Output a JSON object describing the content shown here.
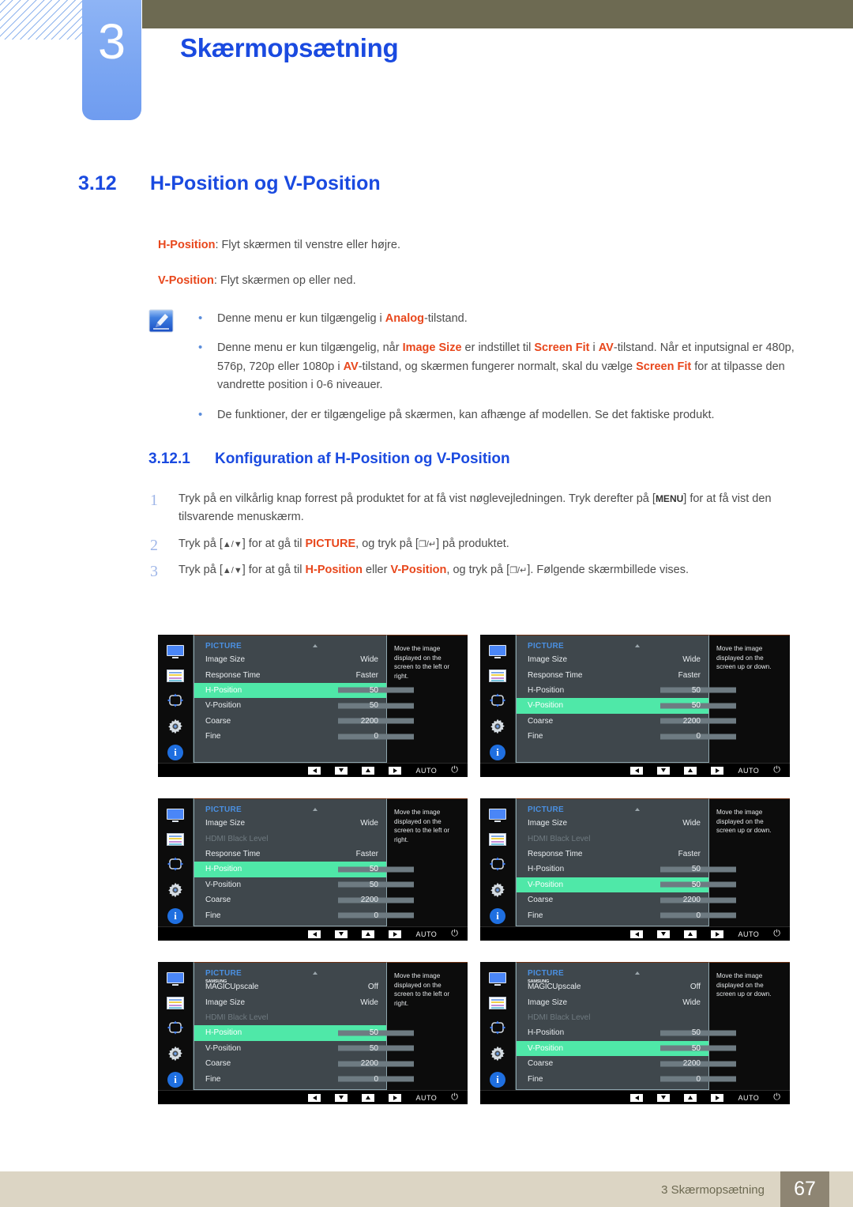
{
  "header": {
    "chapter_number": "3",
    "chapter_title": "Skærmopsætning"
  },
  "section": {
    "number": "3.12",
    "title": "H-Position og V-Position",
    "paragraph1_key": "H-Position",
    "paragraph1_text": ": Flyt skærmen til venstre eller højre.",
    "paragraph2_key": "V-Position",
    "paragraph2_text": ": Flyt skærmen op eller ned."
  },
  "notes": {
    "icon": "note-pencil-icon",
    "items": [
      "Denne menu er kun tilgængelig i Analog-tilstand.",
      "Denne menu er kun tilgængelig, når Image Size er indstillet til Screen Fit i AV-tilstand. Når et inputsignal er 480p, 576p, 720p eller 1080p i AV-tilstand, og skærmen fungerer normalt, skal du vælge Screen Fit for at tilpasse den vandrette position i 0-6 niveauer.",
      "De funktioner, der er tilgængelige på skærmen, kan afhænge af modellen. Se det faktiske produkt."
    ]
  },
  "subsection": {
    "number": "3.12.1",
    "title": "Konfiguration af H-Position og V-Position",
    "steps": [
      {
        "n": "1",
        "text": "Tryk på en vilkårlig knap forrest på produktet for at få vist nøglevejledningen. Tryk derefter på [MENU] for at få vist den tilsvarende menuskærm."
      },
      {
        "n": "2",
        "text": "Tryk på [▲/▼] for at gå til PICTURE, og tryk på [□/↵] på produktet."
      },
      {
        "n": "3",
        "text": "Tryk på [▲/▼] for at gå til H-Position eller V-Position, og tryk på [□/↵]. Følgende skærmbillede vises."
      }
    ]
  },
  "osd": {
    "menu_title": "PICTURE",
    "sidebar_icons": [
      "monitor-icon",
      "picture-bars-icon",
      "move-arrows-icon",
      "gear-icon",
      "info-icon"
    ],
    "footer_buttons": [
      "left-arrow-button",
      "down-arrow-button",
      "up-arrow-button",
      "right-arrow-button"
    ],
    "auto_label": "AUTO",
    "power_icon": "power-icon",
    "help_left": "Move the image displayed on the screen to the left or right.",
    "help_updown": "Move the image displayed on the screen up or down.",
    "accent_highlight": "#4fe8a8",
    "title_color": "#4a90e2",
    "panels": [
      {
        "id": "panel-1-h-position",
        "help": "Move the image displayed on the screen to the left or right.",
        "rows": [
          {
            "label": "Image Size",
            "value": "Wide",
            "type": "value",
            "state": "normal"
          },
          {
            "label": "Response Time",
            "value": "Faster",
            "type": "value",
            "state": "normal"
          },
          {
            "label": "H-Position",
            "value": "50",
            "type": "slider",
            "fill": 50,
            "state": "selected"
          },
          {
            "label": "V-Position",
            "value": "50",
            "type": "slider",
            "fill": 50,
            "state": "normal"
          },
          {
            "label": "Coarse",
            "value": "2200",
            "type": "slider",
            "fill": 50,
            "state": "normal"
          },
          {
            "label": "Fine",
            "value": "0",
            "type": "slider",
            "fill": 0,
            "state": "normal"
          }
        ]
      },
      {
        "id": "panel-2-v-position",
        "help": "Move the image displayed on the screen up or down.",
        "rows": [
          {
            "label": "Image Size",
            "value": "Wide",
            "type": "value",
            "state": "normal"
          },
          {
            "label": "Response Time",
            "value": "Faster",
            "type": "value",
            "state": "normal"
          },
          {
            "label": "H-Position",
            "value": "50",
            "type": "slider",
            "fill": 50,
            "state": "normal"
          },
          {
            "label": "V-Position",
            "value": "50",
            "type": "slider",
            "fill": 50,
            "state": "selected"
          },
          {
            "label": "Coarse",
            "value": "2200",
            "type": "slider",
            "fill": 50,
            "state": "normal"
          },
          {
            "label": "Fine",
            "value": "0",
            "type": "slider",
            "fill": 0,
            "state": "normal"
          }
        ]
      },
      {
        "id": "panel-3-h-position-hdmi",
        "help": "Move the image displayed on the screen to the left or right.",
        "rows": [
          {
            "label": "Image Size",
            "value": "Wide",
            "type": "value",
            "state": "normal"
          },
          {
            "label": "HDMI Black Level",
            "value": "",
            "type": "value",
            "state": "dim"
          },
          {
            "label": "Response Time",
            "value": "Faster",
            "type": "value",
            "state": "normal"
          },
          {
            "label": "H-Position",
            "value": "50",
            "type": "slider",
            "fill": 50,
            "state": "selected"
          },
          {
            "label": "V-Position",
            "value": "50",
            "type": "slider",
            "fill": 50,
            "state": "normal"
          },
          {
            "label": "Coarse",
            "value": "2200",
            "type": "slider",
            "fill": 50,
            "state": "normal"
          },
          {
            "label": "Fine",
            "value": "0",
            "type": "slider",
            "fill": 0,
            "state": "normal"
          }
        ]
      },
      {
        "id": "panel-4-v-position-hdmi",
        "help": "Move the image displayed on the screen up or down.",
        "rows": [
          {
            "label": "Image Size",
            "value": "Wide",
            "type": "value",
            "state": "normal"
          },
          {
            "label": "HDMI Black Level",
            "value": "",
            "type": "value",
            "state": "dim"
          },
          {
            "label": "Response Time",
            "value": "Faster",
            "type": "value",
            "state": "normal"
          },
          {
            "label": "H-Position",
            "value": "50",
            "type": "slider",
            "fill": 50,
            "state": "normal"
          },
          {
            "label": "V-Position",
            "value": "50",
            "type": "slider",
            "fill": 50,
            "state": "selected"
          },
          {
            "label": "Coarse",
            "value": "2200",
            "type": "slider",
            "fill": 50,
            "state": "normal"
          },
          {
            "label": "Fine",
            "value": "0",
            "type": "slider",
            "fill": 0,
            "state": "normal"
          }
        ]
      },
      {
        "id": "panel-5-h-position-magic",
        "help": "Move the image displayed on the screen to the left or right.",
        "rows": [
          {
            "label": "Upscale",
            "brand": "SAMSUNG",
            "brand2": "MAGIC",
            "value": "Off",
            "type": "magic",
            "state": "normal"
          },
          {
            "label": "Image Size",
            "value": "Wide",
            "type": "value",
            "state": "normal"
          },
          {
            "label": "HDMI Black Level",
            "value": "",
            "type": "value",
            "state": "dim"
          },
          {
            "label": "H-Position",
            "value": "50",
            "type": "slider",
            "fill": 50,
            "state": "selected"
          },
          {
            "label": "V-Position",
            "value": "50",
            "type": "slider",
            "fill": 50,
            "state": "normal"
          },
          {
            "label": "Coarse",
            "value": "2200",
            "type": "slider",
            "fill": 50,
            "state": "normal"
          },
          {
            "label": "Fine",
            "value": "0",
            "type": "slider",
            "fill": 0,
            "state": "normal"
          }
        ]
      },
      {
        "id": "panel-6-v-position-magic",
        "help": "Move the image displayed on the screen up or down.",
        "rows": [
          {
            "label": "Upscale",
            "brand": "SAMSUNG",
            "brand2": "MAGIC",
            "value": "Off",
            "type": "magic",
            "state": "normal"
          },
          {
            "label": "Image Size",
            "value": "Wide",
            "type": "value",
            "state": "normal"
          },
          {
            "label": "HDMI Black Level",
            "value": "",
            "type": "value",
            "state": "dim"
          },
          {
            "label": "H-Position",
            "value": "50",
            "type": "slider",
            "fill": 50,
            "state": "normal"
          },
          {
            "label": "V-Position",
            "value": "50",
            "type": "slider",
            "fill": 50,
            "state": "selected"
          },
          {
            "label": "Coarse",
            "value": "2200",
            "type": "slider",
            "fill": 50,
            "state": "normal"
          },
          {
            "label": "Fine",
            "value": "0",
            "type": "slider",
            "fill": 0,
            "state": "normal"
          }
        ]
      }
    ]
  },
  "footer": {
    "text": "3 Skærmopsætning",
    "page": "67"
  }
}
